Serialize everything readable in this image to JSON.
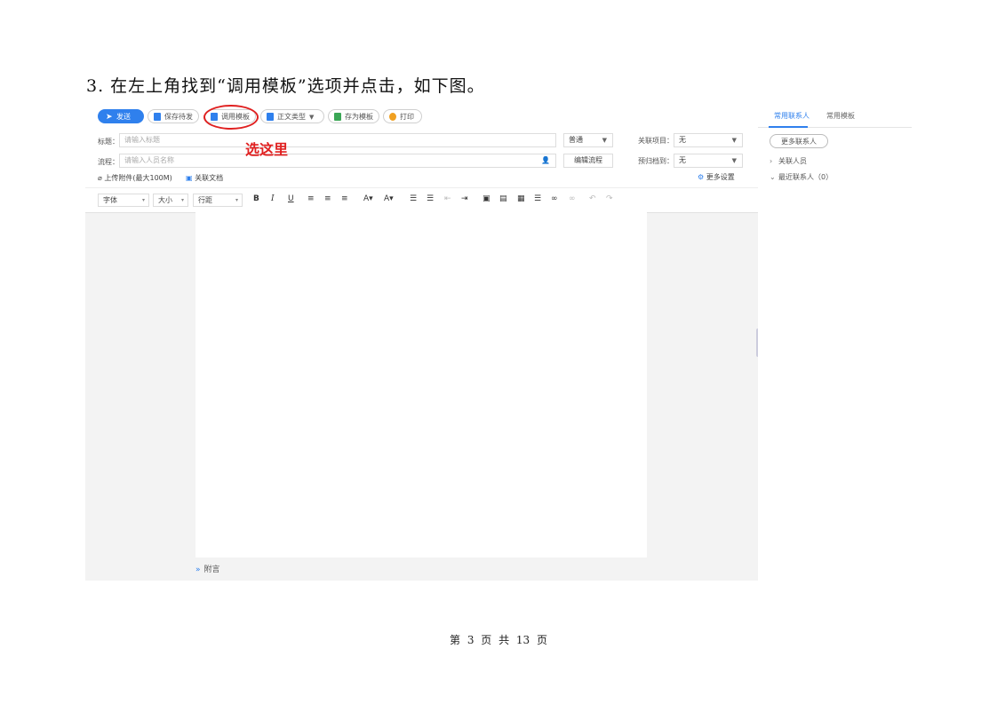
{
  "doc": {
    "heading": "3. 在左上角找到“调用模板”选项并点击，如下图。",
    "footer": "第 3 页 共 13 页"
  },
  "screenshot": {
    "toolbar": {
      "send": "发送",
      "save_draft": "保存待发",
      "call_template": "调用模板",
      "body_type": "正文类型",
      "save_as_template": "存为模板",
      "print": "打印"
    },
    "form": {
      "title_label": "标题：",
      "title_placeholder": "请输入标题",
      "priority_value": "普通",
      "related_project_label": "关联项目：",
      "related_project_value": "无",
      "flow_label": "流程：",
      "flow_placeholder": "请输入人员名称",
      "edit_flow": "编辑流程",
      "archive_label": "预归档到：",
      "archive_value": "无",
      "upload_attachment": "上传附件(最大100M)",
      "related_doc": "关联文档",
      "more_settings": "更多设置"
    },
    "format_bar": {
      "font": "字体",
      "size": "大小",
      "line_height": "行距"
    },
    "attach_note": "附言"
  },
  "annotation": {
    "callout": "选这里",
    "color": "#e02020"
  },
  "right_panel": {
    "tabs": [
      "常用联系人",
      "常用模板"
    ],
    "more_contacts": "更多联系人",
    "tree": [
      "关联人员",
      "最近联系人（0）"
    ]
  },
  "colors": {
    "accent": "#2f80ed"
  }
}
